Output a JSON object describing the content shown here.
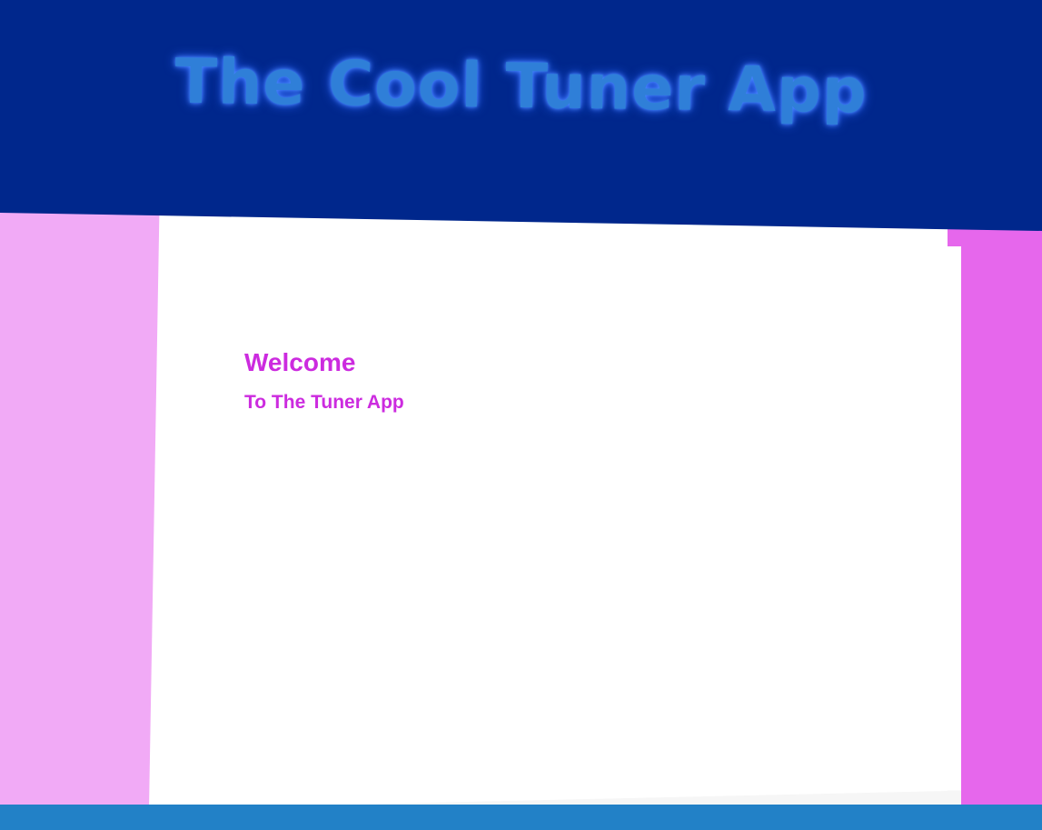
{
  "header": {
    "title": "The Cool Tuner App"
  },
  "main": {
    "welcome_title": "Welcome",
    "welcome_subtitle": "To The Tuner App"
  },
  "colors": {
    "header_bg": "#00278c",
    "title_glow": "#2f7fd8",
    "left_panel": "#f1aaf6",
    "right_panel": "#e667ec",
    "accent_text": "#cc2bdf",
    "footer_bg": "#2281c7"
  }
}
